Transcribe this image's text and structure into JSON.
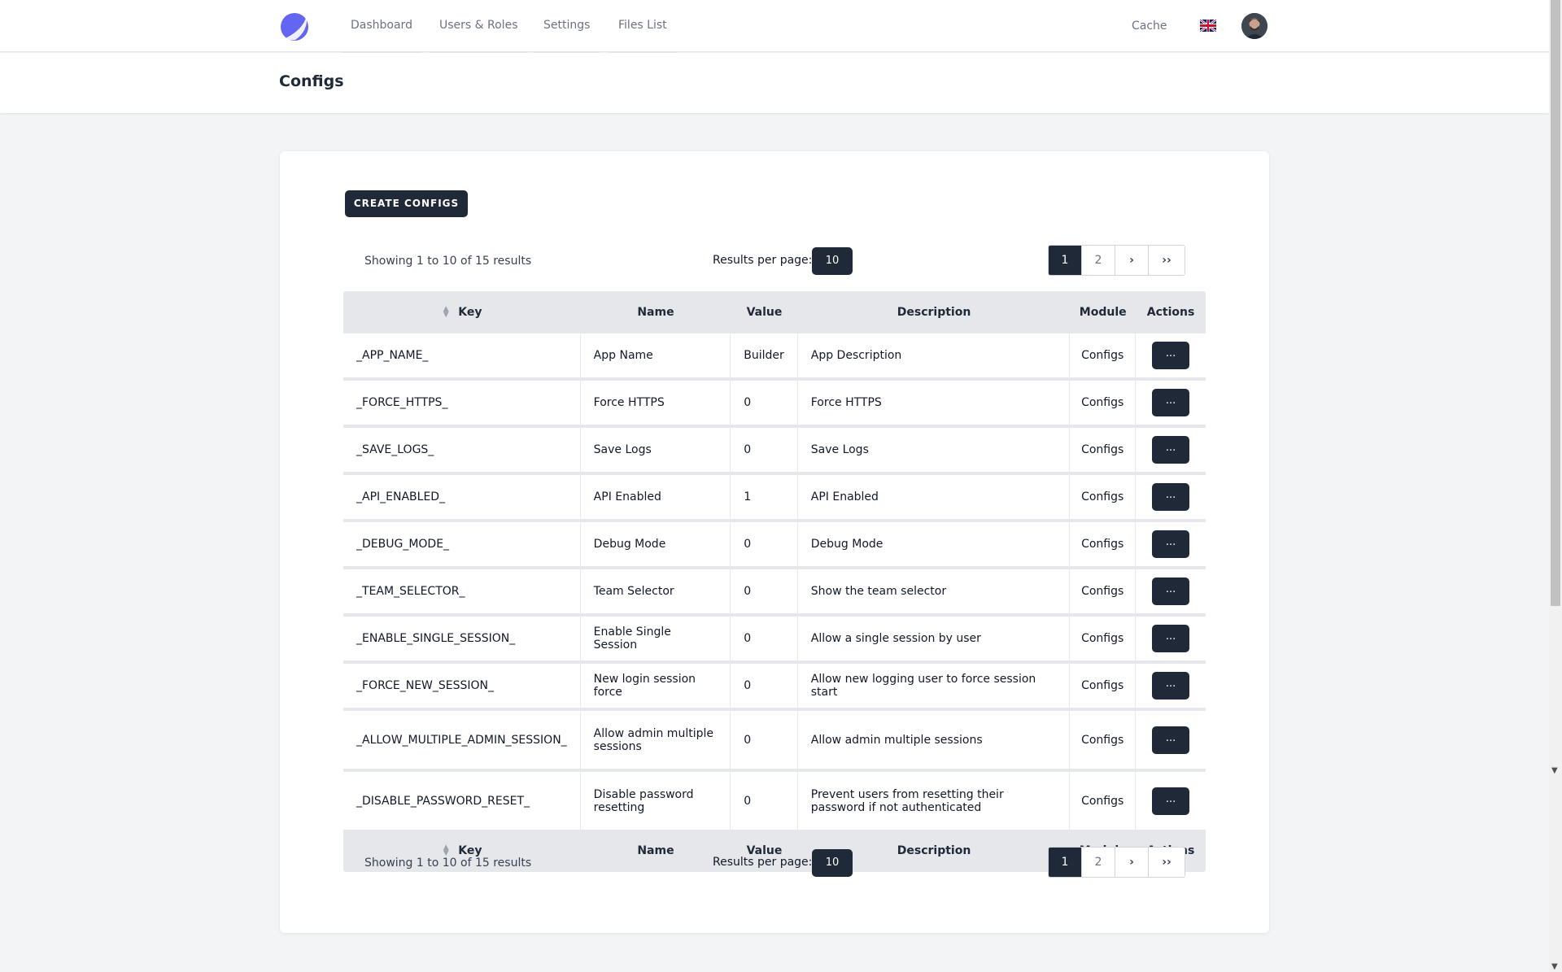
{
  "nav": {
    "links": [
      "Dashboard",
      "Users & Roles",
      "Settings",
      "Files List"
    ],
    "cache": "Cache"
  },
  "page": {
    "title": "Configs"
  },
  "toolbar": {
    "create_label": "CREATE CONFIGS"
  },
  "pagination": {
    "showing": "Showing 1 to 10 of 15 results",
    "results_per_page_label": "Results per page:",
    "results_per_page_value": "10",
    "pages": [
      "1",
      "2"
    ],
    "next": "›",
    "last": "››"
  },
  "table": {
    "headers": [
      "Key",
      "Name",
      "Value",
      "Description",
      "Module",
      "Actions"
    ],
    "action_label": "...",
    "rows": [
      [
        "_APP_NAME_",
        "App Name",
        "Builder",
        "App Description",
        "Configs"
      ],
      [
        "_FORCE_HTTPS_",
        "Force HTTPS",
        "0",
        "Force HTTPS",
        "Configs"
      ],
      [
        "_SAVE_LOGS_",
        "Save Logs",
        "0",
        "Save Logs",
        "Configs"
      ],
      [
        "_API_ENABLED_",
        "API Enabled",
        "1",
        "API Enabled",
        "Configs"
      ],
      [
        "_DEBUG_MODE_",
        "Debug Mode",
        "0",
        "Debug Mode",
        "Configs"
      ],
      [
        "_TEAM_SELECTOR_",
        "Team Selector",
        "0",
        "Show the team selector",
        "Configs"
      ],
      [
        "_ENABLE_SINGLE_SESSION_",
        "Enable Single Session",
        "0",
        "Allow a single session by user",
        "Configs"
      ],
      [
        "_FORCE_NEW_SESSION_",
        "New login session force",
        "0",
        "Allow new logging user to force session start",
        "Configs"
      ],
      [
        "_ALLOW_MULTIPLE_ADMIN_SESSION_",
        "Allow admin multiple sessions",
        "0",
        "Allow admin multiple sessions",
        "Configs"
      ],
      [
        "_DISABLE_PASSWORD_RESET_",
        "Disable password resetting",
        "0",
        "Prevent users from resetting their password if not authenticated",
        "Configs"
      ]
    ]
  },
  "colors": {
    "primary_dark": "#1f2937",
    "page_bg": "#f3f4f6",
    "logo": "#6366f1"
  },
  "icons": [
    "logo-icon",
    "uk-flag-icon",
    "avatar",
    "sort-icon",
    "chevron-right-icon",
    "double-chevron-right-icon"
  ]
}
